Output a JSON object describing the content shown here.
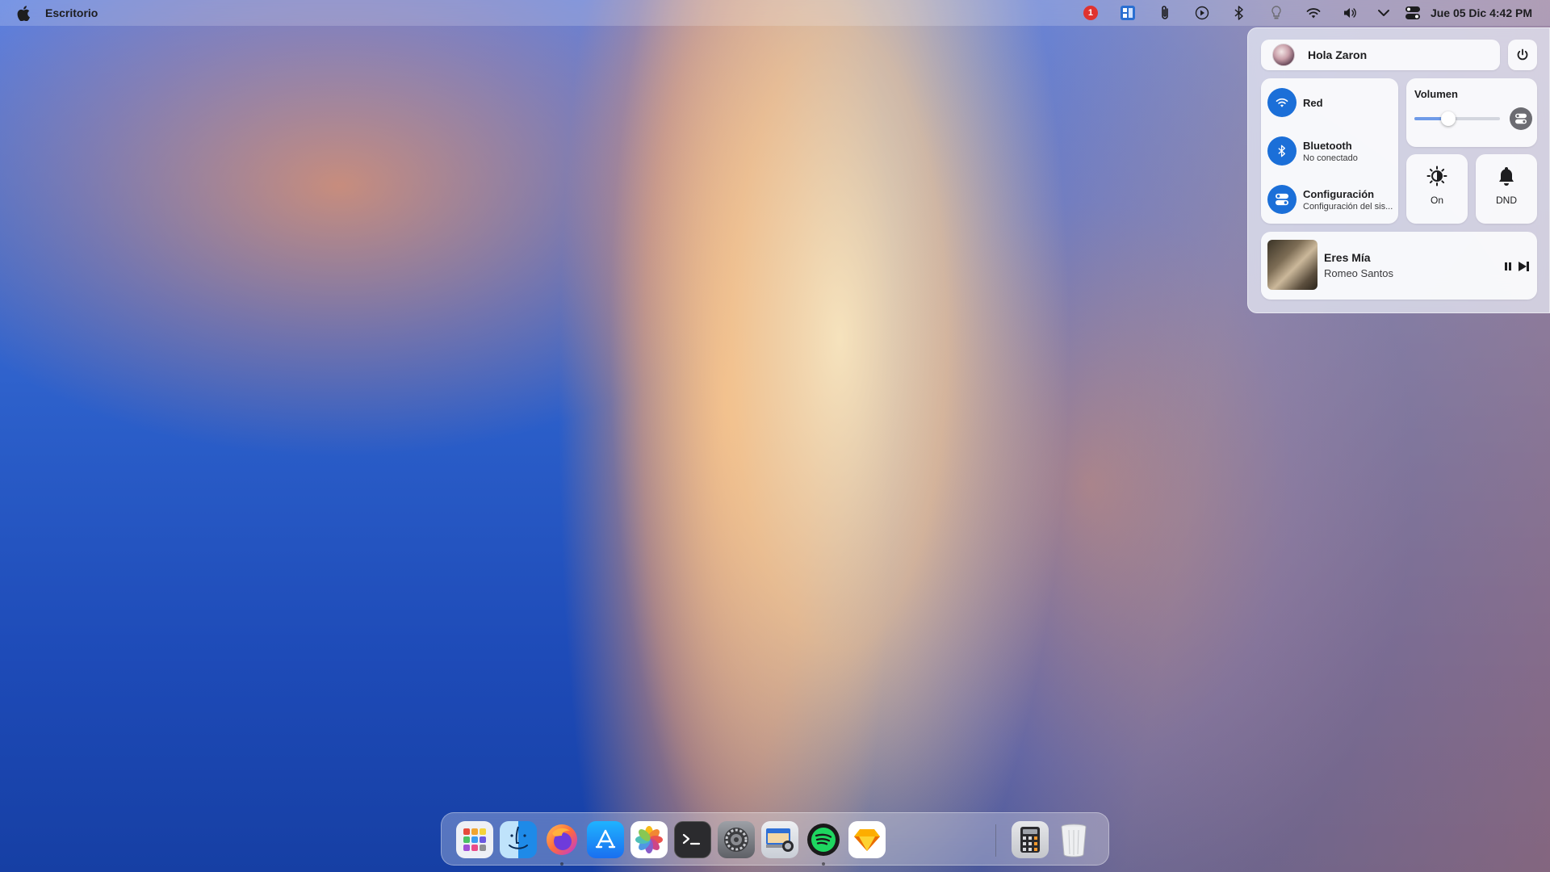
{
  "menubar": {
    "app_name": "Escritorio",
    "notification_count": "1",
    "clock": "Jue 05 Dic  4:42 PM",
    "icons": [
      "apple-icon",
      "notification-badge-icon",
      "window-manager-icon",
      "paperclip-icon",
      "play-circle-icon",
      "bluetooth-icon",
      "lightbulb-icon",
      "wifi-icon",
      "volume-icon",
      "chevron-down-icon",
      "control-center-toggle-icon"
    ]
  },
  "control_center": {
    "greeting": "Hola Zaron",
    "network": {
      "label": "Red"
    },
    "bluetooth": {
      "label": "Bluetooth",
      "status": "No conectado"
    },
    "settings": {
      "label": "Configuración",
      "subtitle": "Configuración del sis..."
    },
    "volume": {
      "label": "Volumen",
      "level_percent": 40
    },
    "theme_tile": {
      "label": "On"
    },
    "dnd_tile": {
      "label": "DND"
    },
    "now_playing": {
      "title": "Eres Mía",
      "artist": "Romeo Santos"
    }
  },
  "dock": {
    "apps": [
      {
        "name": "launchpad",
        "running": false
      },
      {
        "name": "finder",
        "running": false
      },
      {
        "name": "firefox",
        "running": true
      },
      {
        "name": "app-store",
        "running": false
      },
      {
        "name": "photos",
        "running": false
      },
      {
        "name": "terminal",
        "running": false
      },
      {
        "name": "system-settings",
        "running": false
      },
      {
        "name": "screenshot",
        "running": false
      },
      {
        "name": "spotify",
        "running": true
      },
      {
        "name": "sketch",
        "running": false
      },
      {
        "name": "calculator",
        "running": false
      },
      {
        "name": "trash",
        "running": false
      }
    ]
  },
  "colors": {
    "accent": "#1b6fd8",
    "badge": "#e0332f"
  }
}
